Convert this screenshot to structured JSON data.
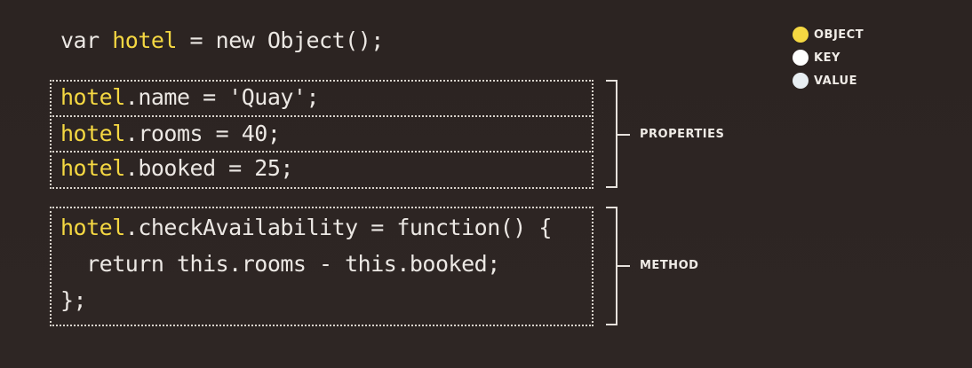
{
  "code": {
    "declaration": {
      "keyword": "var ",
      "object": "hotel",
      "rest": " = new Object();"
    },
    "properties": [
      {
        "object": "hotel",
        "rest": ".name = 'Quay';"
      },
      {
        "object": "hotel",
        "rest": ".rooms = 40;"
      },
      {
        "object": "hotel",
        "rest": ".booked = 25;"
      }
    ],
    "method": {
      "line1": {
        "object": "hotel",
        "rest": ".checkAvailability = function() {"
      },
      "line2": "  return this.rooms - this.booked;",
      "line3": "};"
    }
  },
  "annotations": {
    "properties": "PROPERTIES",
    "method": "METHOD"
  },
  "legend": [
    {
      "label": "OBJECT",
      "color": "#f5d842"
    },
    {
      "label": "KEY",
      "color": "#ffffff"
    },
    {
      "label": "VALUE",
      "color": "#e8eef2"
    }
  ]
}
